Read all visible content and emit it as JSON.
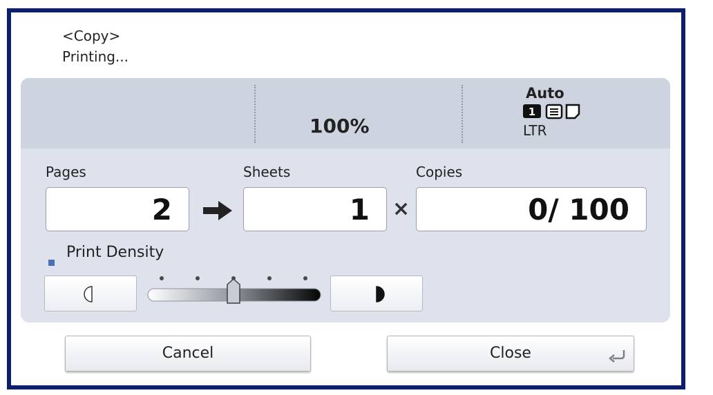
{
  "header": {
    "mode": "<Copy>",
    "status": "Printing..."
  },
  "info_bar": {
    "ratio": "100%",
    "paper_source": "Auto",
    "paper_icons": [
      "tray-1-icon",
      "paper-stack-icon",
      "paper-sheet-icon"
    ],
    "paper_size": "LTR"
  },
  "counters": {
    "pages_label": "Pages",
    "pages_value": "2",
    "sheets_label": "Sheets",
    "sheets_value": "1",
    "times_symbol": "×",
    "copies_label": "Copies",
    "copies_value": "0/  100"
  },
  "density": {
    "label": "Print Density",
    "level_fraction": 0.5,
    "lighter_icon": "half-circle-light-icon",
    "darker_icon": "half-circle-dark-icon"
  },
  "buttons": {
    "cancel": "Cancel",
    "close": "Close"
  },
  "colors": {
    "frame_border": "#0d1f6b",
    "panel_bg": "#dde2ec",
    "info_strip_bg": "#cdd3df",
    "density_bullet": "#4a6fb4"
  }
}
